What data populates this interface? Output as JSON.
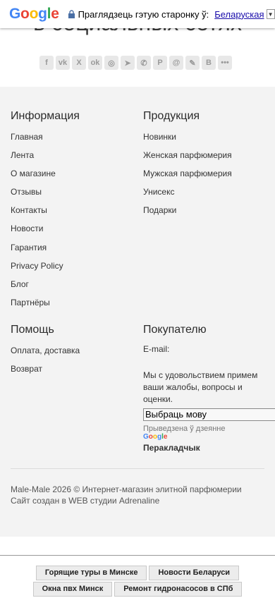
{
  "translate_bar": {
    "logo": "Google",
    "prompt": "Праглядзець гэтую старонку ў:",
    "language": "Беларуская"
  },
  "page": {
    "heading_peek": "в социальных сетях"
  },
  "share_icons": [
    "facebook-icon",
    "vk-icon",
    "x-icon",
    "odnoklassniki-icon",
    "whatsapp-icon",
    "telegram-icon",
    "viber-icon",
    "pinterest-icon",
    "email-icon",
    "livejournal-icon",
    "blogger-icon",
    "more-icon"
  ],
  "footer": {
    "info": {
      "title": "Информация",
      "items": [
        "Главная",
        "Лента",
        "О магазине",
        "Отзывы",
        "Контакты",
        "Новости",
        "Гарантия",
        "Privacy Policy",
        "Блог",
        "Партнёры"
      ]
    },
    "products": {
      "title": "Продукция",
      "items": [
        "Новинки",
        "Женская парфюмерия",
        "Мужская парфюмерия",
        "Унисекс",
        "Подарки"
      ]
    },
    "help": {
      "title": "Помощь",
      "items": [
        "Оплата, доставка",
        "Возврат"
      ]
    },
    "buyer": {
      "title": "Покупателю",
      "email_label": "E-mail:",
      "note": "Мы с удовольствием примем ваши жалобы, вопросы и оценки.",
      "language_select": "Выбраць мову",
      "powered_by": "Прыведзена ў дзеянне",
      "powered_logo": "Google",
      "translator": "Перакладчык"
    },
    "copyright_line1": "Male-Male 2026 © Интернет-магазин элитной парфюмерии",
    "copyright_line2": "Сайт создан в WEB студии Adrenaline"
  },
  "bottom_links": {
    "row1": [
      "Горящие туры в Минске",
      "Новости Беларуси"
    ],
    "row2": [
      "Окна пвх Минск",
      "Ремонт гидронасосов в СПб"
    ]
  }
}
